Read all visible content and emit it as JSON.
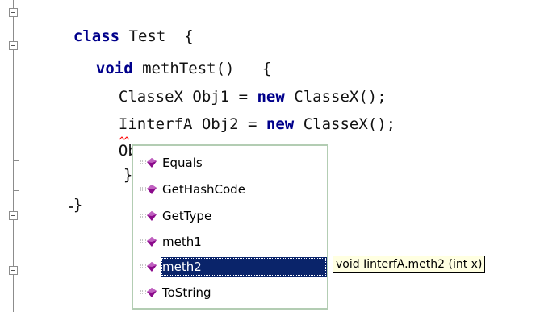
{
  "code": {
    "line1": {
      "kw": "class",
      "rest": " Test  {"
    },
    "line2": {
      "kw": "void",
      "rest": " methTest()   {"
    },
    "line3": {
      "pre": "ClasseX Obj1 = ",
      "kw": "new",
      "post": " ClasseX();"
    },
    "line4": {
      "pre": "IinterfA Obj2 = ",
      "kw": "new",
      "post": " ClasseX();"
    },
    "line5": "Obj2.",
    "line6": "}",
    "line7": "}"
  },
  "completion": {
    "items": [
      {
        "label": "Equals",
        "icon": "method-icon"
      },
      {
        "label": "GetHashCode",
        "icon": "method-icon"
      },
      {
        "label": "GetType",
        "icon": "method-icon"
      },
      {
        "label": "meth1",
        "icon": "method-icon"
      },
      {
        "label": "meth2",
        "icon": "method-icon",
        "selected": true
      },
      {
        "label": "ToString",
        "icon": "method-icon"
      }
    ]
  },
  "tooltip": {
    "text": "void IinterfA.meth2 (int x)"
  },
  "colors": {
    "keyword": "#00008b",
    "selection": "#0a246a",
    "tooltip_bg": "#ffffe1",
    "method_icon": "#8b0a8b",
    "squiggle": "#ff0000"
  }
}
